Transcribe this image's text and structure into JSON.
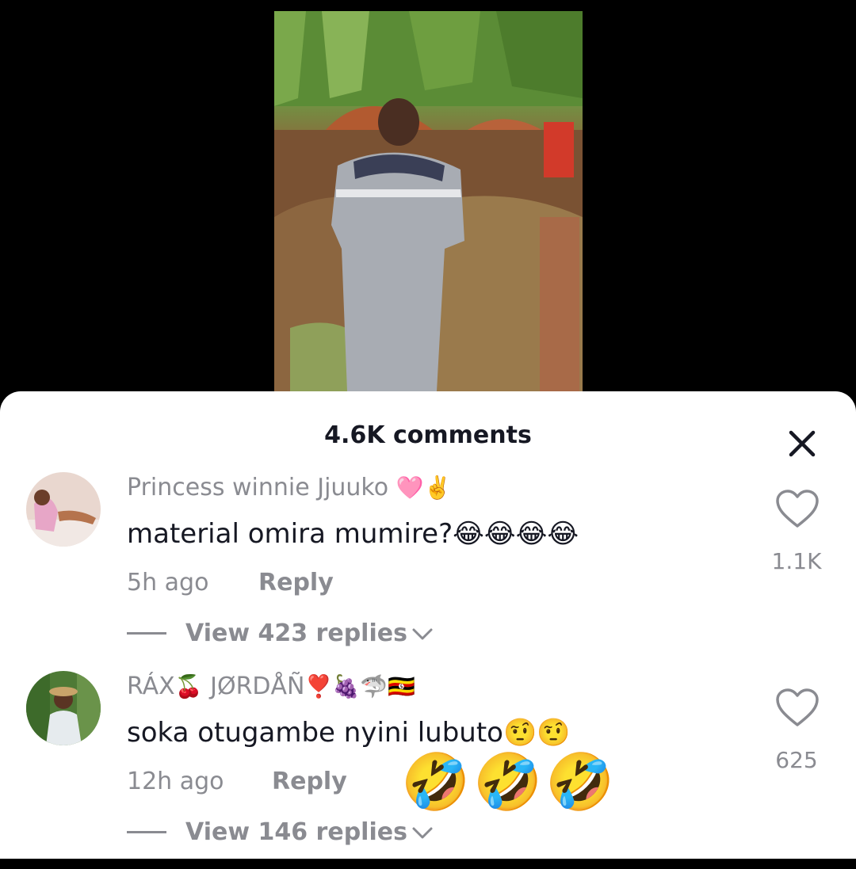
{
  "video": {
    "description_icon": "video-frame"
  },
  "sheet": {
    "title": "4.6K comments",
    "close_icon": "close-icon"
  },
  "comments": [
    {
      "username": "Princess winnie Jjuuko",
      "username_emoji": "🩷✌️",
      "text": "material omira mumire?",
      "text_emoji": "😂😂😂😂",
      "time": "5h ago",
      "reply_label": "Reply",
      "view_replies": "View 423 replies",
      "likes": "1.1K"
    },
    {
      "username_part1": "RÁX",
      "username_emoji1": "🍒",
      "username_part2": "JØRDÅÑ",
      "username_emoji2": "❣️🍇🦈🇺🇬",
      "text": "soka otugambe nyini lubuto",
      "text_emoji": "🤨🤨",
      "time": "12h ago",
      "reply_label": "Reply",
      "view_replies": "View 146 replies",
      "likes": "625"
    }
  ],
  "floating_emoji": "🤣🤣🤣",
  "colors": {
    "sheet": "#ffffff",
    "text": "#161823",
    "muted": "#8a8b91",
    "backdrop": "#000000"
  }
}
